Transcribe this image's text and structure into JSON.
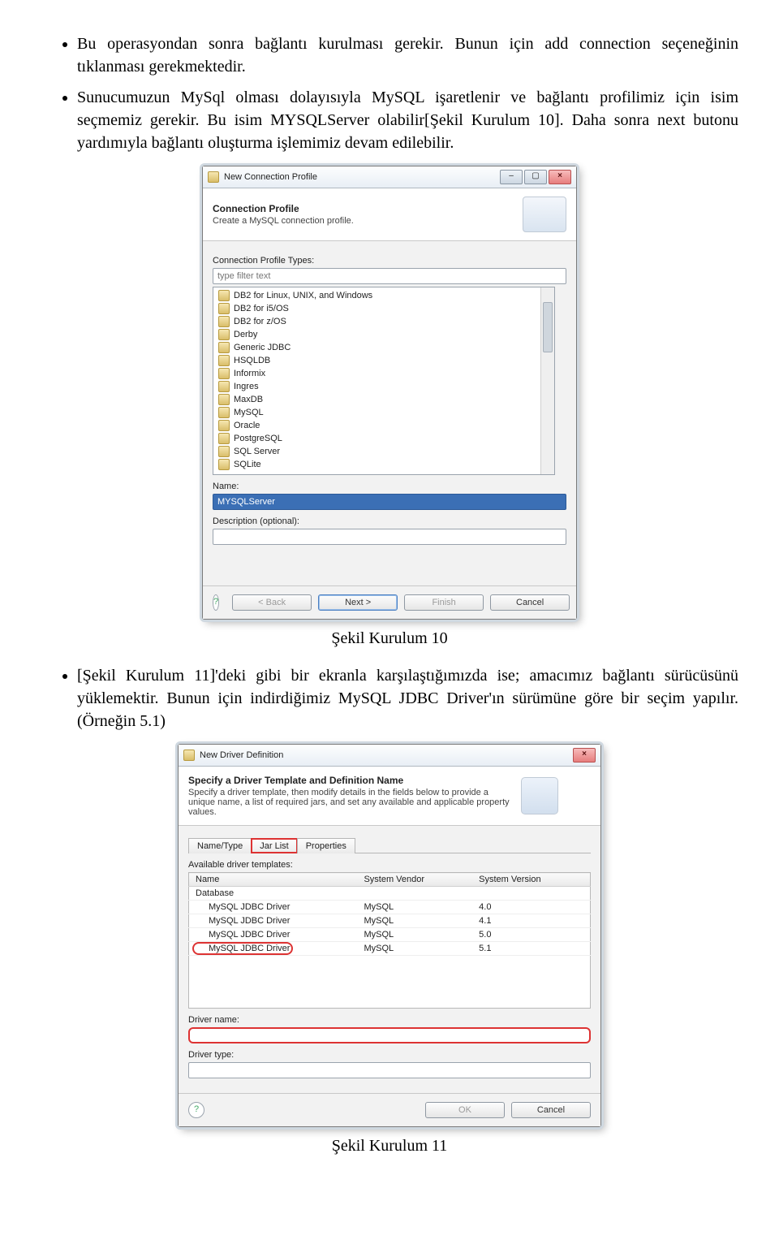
{
  "doc": {
    "bullet1": "Bu operasyondan sonra bağlantı kurulması gerekir. Bunun için add connection seçeneğinin tıklanması gerekmektedir.",
    "bullet2": "Sunucumuzun MySql olması dolayısıyla MySQL işaretlenir ve bağlantı profilimiz için isim seçmemiz gerekir. Bu isim MYSQLServer olabilir[Şekil Kurulum 10]. Daha sonra next butonu yardımıyla bağlantı oluşturma işlemimiz devam edilebilir.",
    "caption1": "Şekil Kurulum 10",
    "bullet3": "[Şekil Kurulum 11]'deki gibi bir ekranla karşılaştığımızda ise; amacımız bağlantı sürücüsünü yüklemektir. Bunun için indirdiğimiz MySQL JDBC Driver'ın sürümüne göre bir seçim yapılır.(Örneğin 5.1)",
    "caption2": "Şekil Kurulum 11"
  },
  "dlg1": {
    "title": "New Connection Profile",
    "header_title": "Connection Profile",
    "header_desc": "Create a MySQL connection profile.",
    "types_label": "Connection Profile Types:",
    "filter_placeholder": "type filter text",
    "items": [
      "DB2 for Linux, UNIX, and Windows",
      "DB2 for i5/OS",
      "DB2 for z/OS",
      "Derby",
      "Generic JDBC",
      "HSQLDB",
      "Informix",
      "Ingres",
      "MaxDB",
      "MySQL",
      "Oracle",
      "PostgreSQL",
      "SQL Server",
      "SQLite"
    ],
    "name_label": "Name:",
    "name_value": "MYSQLServer",
    "desc_label": "Description (optional):",
    "btn_back": "< Back",
    "btn_next": "Next >",
    "btn_finish": "Finish",
    "btn_cancel": "Cancel"
  },
  "dlg2": {
    "title": "New Driver Definition",
    "header_title": "Specify a Driver Template and Definition Name",
    "header_desc": "Specify a driver template, then modify details in the fields below to provide a unique name, a list of required jars, and set any available and applicable property values.",
    "tab1": "Name/Type",
    "tab2": "Jar List",
    "tab3": "Properties",
    "avail_label": "Available driver templates:",
    "col_name": "Name",
    "col_vendor": "System Vendor",
    "col_version": "System Version",
    "cat_row": "Database",
    "rows": [
      {
        "name": "MySQL JDBC Driver",
        "vendor": "MySQL",
        "version": "4.0"
      },
      {
        "name": "MySQL JDBC Driver",
        "vendor": "MySQL",
        "version": "4.1"
      },
      {
        "name": "MySQL JDBC Driver",
        "vendor": "MySQL",
        "version": "5.0"
      },
      {
        "name": "MySQL JDBC Driver",
        "vendor": "MySQL",
        "version": "5.1"
      }
    ],
    "driver_name_label": "Driver name:",
    "driver_type_label": "Driver type:",
    "btn_ok": "OK",
    "btn_cancel": "Cancel"
  }
}
